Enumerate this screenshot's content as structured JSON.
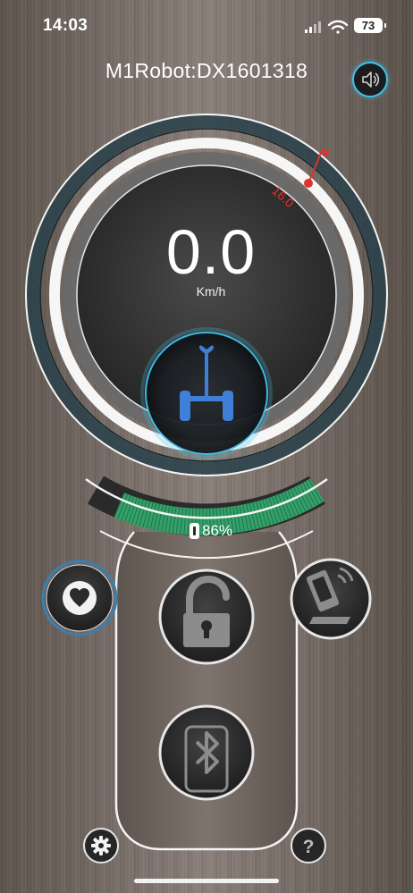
{
  "status_bar": {
    "time": "14:03",
    "battery": "73",
    "icons": [
      "signal-icon",
      "wifi-icon",
      "battery-icon"
    ]
  },
  "header": {
    "title": "M1Robot:DX1601318",
    "sound_icon": "speaker-icon"
  },
  "speedometer": {
    "speed": "0.0",
    "unit": "Km/h",
    "speed_limit": "16.0",
    "center_icon": "self-balancing-scooter-icon"
  },
  "battery": {
    "percent": "86%",
    "level": 0.86
  },
  "controls": {
    "heart": "heart-icon",
    "lock": "unlock-icon",
    "remote": "phone-remote-icon",
    "bluetooth": "bluetooth-icon",
    "settings": "gear-icon",
    "help": "question-icon"
  },
  "colors": {
    "accent_blue": "#3ec1e8",
    "battery_green": "#34a06a",
    "limit_red": "#e0322f",
    "scooter_blue": "#3f7fd8"
  }
}
